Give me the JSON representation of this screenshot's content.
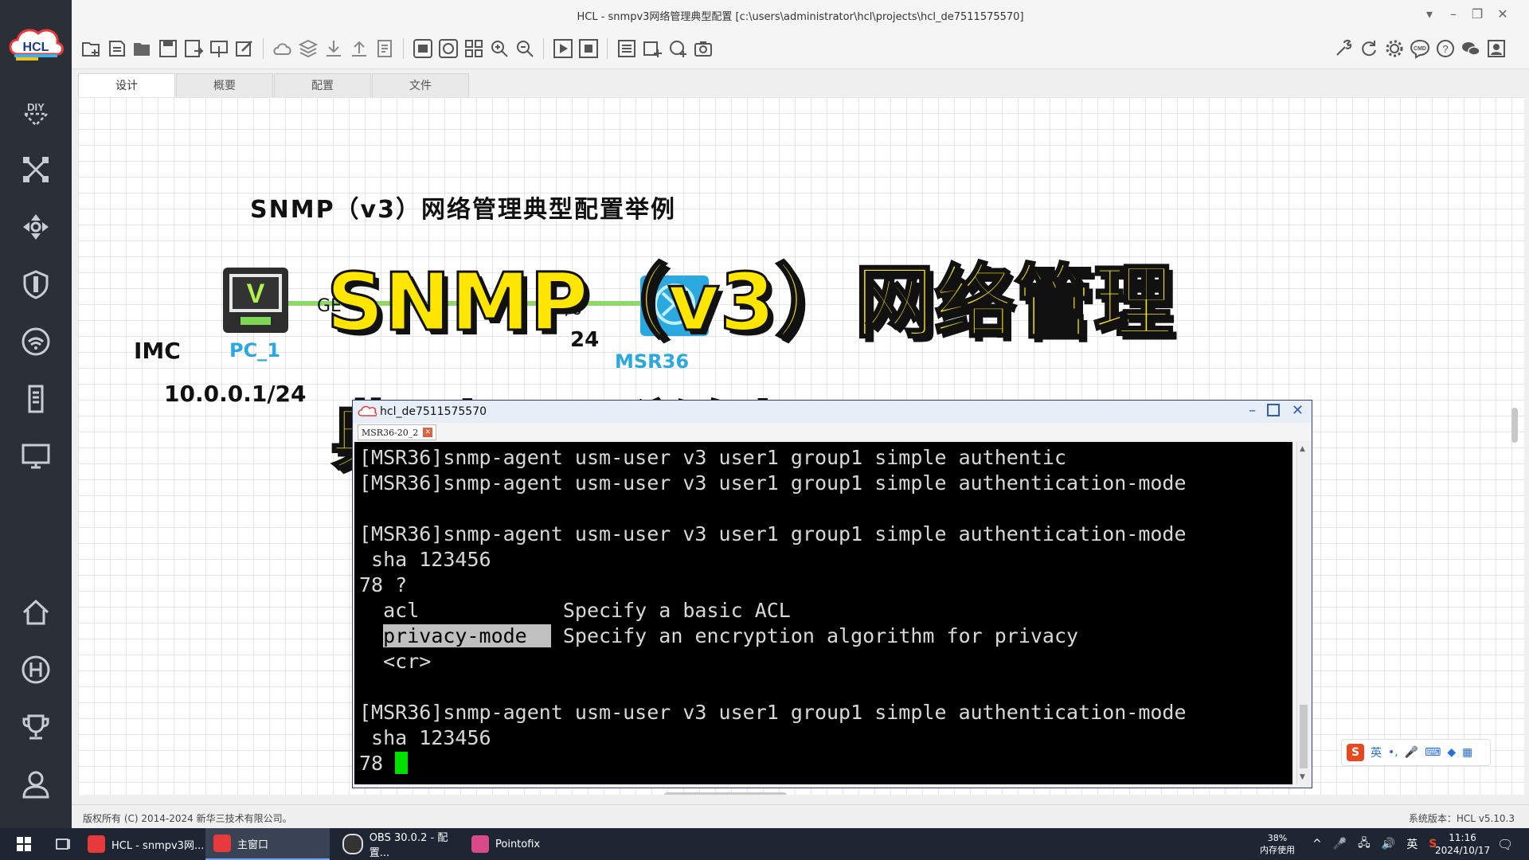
{
  "window": {
    "title": "HCL - snmpv3网络管理典型配置 [c:\\users\\administrator\\hcl\\projects\\hcl_de7511575570]"
  },
  "sidebar": {
    "logo_text": "HCL",
    "icons": [
      "diy-icon",
      "topology-icon",
      "move-icon",
      "shield-icon",
      "wifi-icon",
      "server-icon",
      "monitor-icon",
      "home-icon",
      "h-circle-icon",
      "trophy-icon",
      "user-icon"
    ]
  },
  "tabs": [
    {
      "label": "设计",
      "active": true
    },
    {
      "label": "概要",
      "active": false
    },
    {
      "label": "配置",
      "active": false
    },
    {
      "label": "文件",
      "active": false
    }
  ],
  "canvas": {
    "heading": "SNMP（v3）网络管理典型配置举例",
    "imc_label": "IMC",
    "pc_label": "PC_1",
    "pc_ip": "10.0.0.1/24",
    "iface_left": "GE",
    "iface_right": "/0",
    "iface_mask": "24",
    "router_label": "MSR36"
  },
  "overlay": {
    "line1": "SNMP（v3）网络管理",
    "line2": "典型配置举例"
  },
  "terminal": {
    "title": "hcl_de7511575570",
    "tab": "MSR36-20_2",
    "lines": [
      "[MSR36]snmp-agent usm-user v3 user1 group1 simple authentic",
      "[MSR36]snmp-agent usm-user v3 user1 group1 simple authentication-mode",
      "",
      "[MSR36]snmp-agent usm-user v3 user1 group1 simple authentication-mode",
      " sha 123456",
      "78 ?",
      "  acl            Specify a basic ACL",
      "  privacy-mode   Specify an encryption algorithm for privacy",
      "  <cr>",
      "",
      "[MSR36]snmp-agent usm-user v3 user1 group1 simple authentication-mode",
      " sha 123456",
      "78 "
    ],
    "highlight": "privacy-mode"
  },
  "statusbar": {
    "copyright": "版权所有 (C) 2014-2024 新华三技术有限公司。",
    "version": "系统版本：HCL v5.10.3"
  },
  "taskbar": {
    "apps": [
      {
        "label": "HCL - snmpv3网...",
        "active": false
      },
      {
        "label": "主窗口",
        "active": true
      },
      {
        "label": "OBS 30.0.2 - 配置...",
        "active": false
      },
      {
        "label": "Pointofix",
        "active": false
      }
    ],
    "memory_percent": "38%",
    "memory_label": "内存使用",
    "ime_lang": "英",
    "time": "11:16",
    "date": "2024/10/17"
  },
  "colors": {
    "sidebar_bg": "#2b2f36",
    "link_green": "#8ed86a",
    "overlay_yellow": "#ffe600",
    "terminal_bg": "#000000",
    "cursor_green": "#00e000"
  }
}
